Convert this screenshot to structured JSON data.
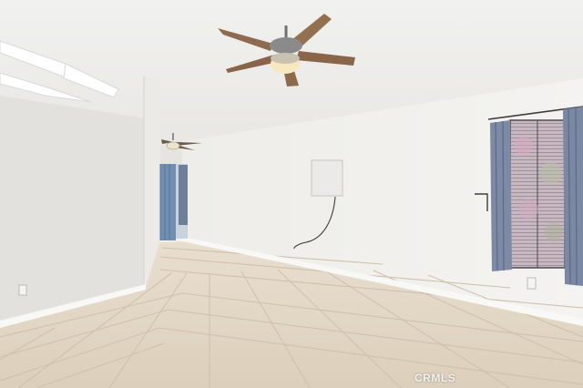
{
  "scene": {
    "description_colors": {
      "ceiling": "#eeeeec",
      "wall_left": "#e6e4e1",
      "wall_right": "#f1f0ee",
      "floor_tile": "#e3d8c8",
      "grout": "#cdbfa9",
      "baseboard": "#f7f7f5",
      "curtain": "#7f8ca6",
      "fan_blade": "#8d6a50"
    }
  },
  "watermark": {
    "text": "CRMLS"
  }
}
